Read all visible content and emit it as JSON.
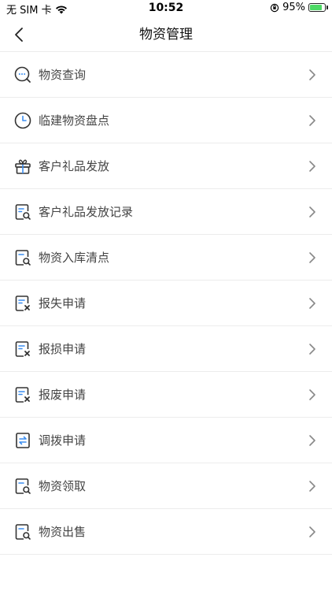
{
  "status": {
    "carrier": "无 SIM 卡",
    "time": "10:52",
    "battery": "95%",
    "battery_level": 0.95,
    "battery_color": "#4cd964"
  },
  "nav": {
    "title": "物资管理",
    "back_icon": "chevron-left-icon"
  },
  "menu": {
    "items": [
      {
        "label": "物资查询",
        "icon": "search-chat-icon"
      },
      {
        "label": "临建物资盘点",
        "icon": "clock-icon"
      },
      {
        "label": "客户礼品发放",
        "icon": "gift-icon"
      },
      {
        "label": "客户礼品发放记录",
        "icon": "doc-search-icon"
      },
      {
        "label": "物资入库清点",
        "icon": "doc-search-icon"
      },
      {
        "label": "报失申请",
        "icon": "doc-close-icon"
      },
      {
        "label": "报损申请",
        "icon": "doc-close-icon"
      },
      {
        "label": "报废申请",
        "icon": "doc-close-icon"
      },
      {
        "label": "调拨申请",
        "icon": "doc-transfer-icon"
      },
      {
        "label": "物资领取",
        "icon": "doc-search-icon"
      },
      {
        "label": "物资出售",
        "icon": "doc-search-icon"
      }
    ]
  },
  "colors": {
    "accent": "#3b8ef0",
    "icon_stroke": "#333333",
    "divider": "#ececec"
  }
}
